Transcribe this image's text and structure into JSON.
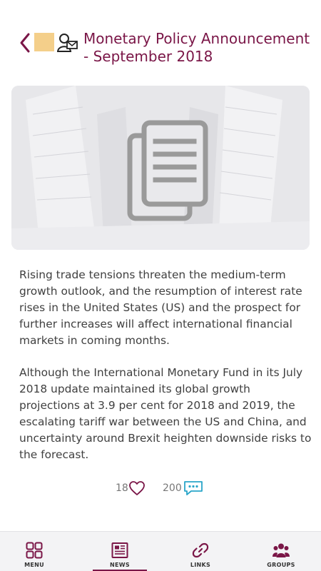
{
  "header": {
    "title": "Monetary Policy Announcement - September 2018"
  },
  "article": {
    "paragraphs": [
      "Rising trade tensions threaten the medium-term growth outlook, and the resumption of interest rate rises in the United States (US) and the prospect for further increases will affect international financial markets in coming months.",
      "Although the International Monetary Fund in its July 2018 update maintained its global growth projections at 3.9 per cent for 2018 and 2019, the escalating tariff war between the US and China, and uncertainty around Brexit heighten downside risks to the forecast."
    ]
  },
  "stats": {
    "likes": "18",
    "comments": "200"
  },
  "tabbar": {
    "tabs": [
      {
        "label": "MENU",
        "icon": "grid-icon",
        "active": false
      },
      {
        "label": "NEWS",
        "icon": "newspaper-icon",
        "active": true
      },
      {
        "label": "LINKS",
        "icon": "link-icon",
        "active": false
      },
      {
        "label": "GROUPS",
        "icon": "group-icon",
        "active": false
      }
    ]
  },
  "colors": {
    "accent": "#7a1647",
    "thumb": "#f4cf8a",
    "comment_icon": "#2aa6c9"
  }
}
